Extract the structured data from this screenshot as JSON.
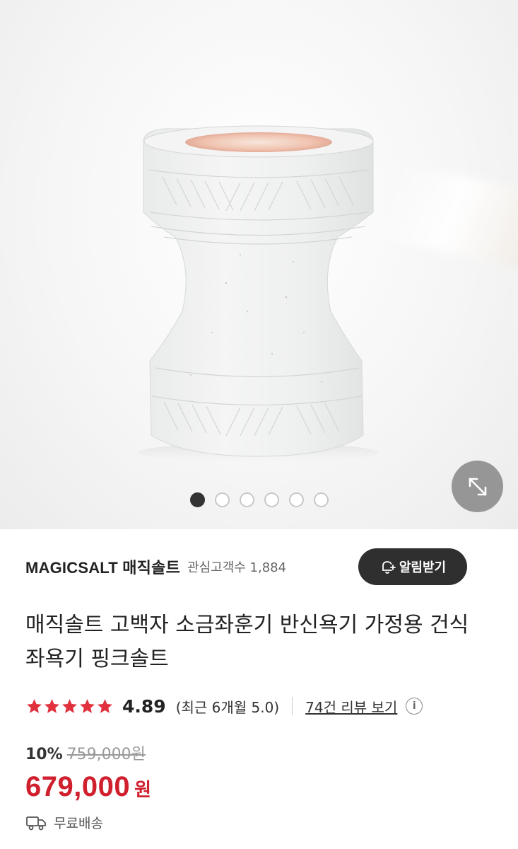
{
  "gallery": {
    "total_images": 6,
    "active_index": 0,
    "expand_icon": "expand-arrows-icon"
  },
  "seller": {
    "brand": "MAGICSALT 매직솔트",
    "followers": "관심고객수 1,884",
    "alarm_button": "알림받기",
    "alarm_icon": "bell-plus-icon"
  },
  "product": {
    "title": "매직솔트 고백자 소금좌훈기 반신욕기 가정용 건식 좌욕기 핑크솔트"
  },
  "rating": {
    "stars": 5,
    "score": "4.89",
    "recent": "(최근 6개월 5.0)",
    "review_link": "74건 리뷰 보기",
    "info_icon_text": "i"
  },
  "price": {
    "discount_rate": "10%",
    "original": "759,000원",
    "sale": "679,000",
    "currency": "원"
  },
  "shipping": {
    "label": "무료배송",
    "icon": "truck-icon"
  },
  "colors": {
    "price_red": "#d0202e",
    "star_red": "#e0313d",
    "button_dark": "#2f2f2f"
  }
}
